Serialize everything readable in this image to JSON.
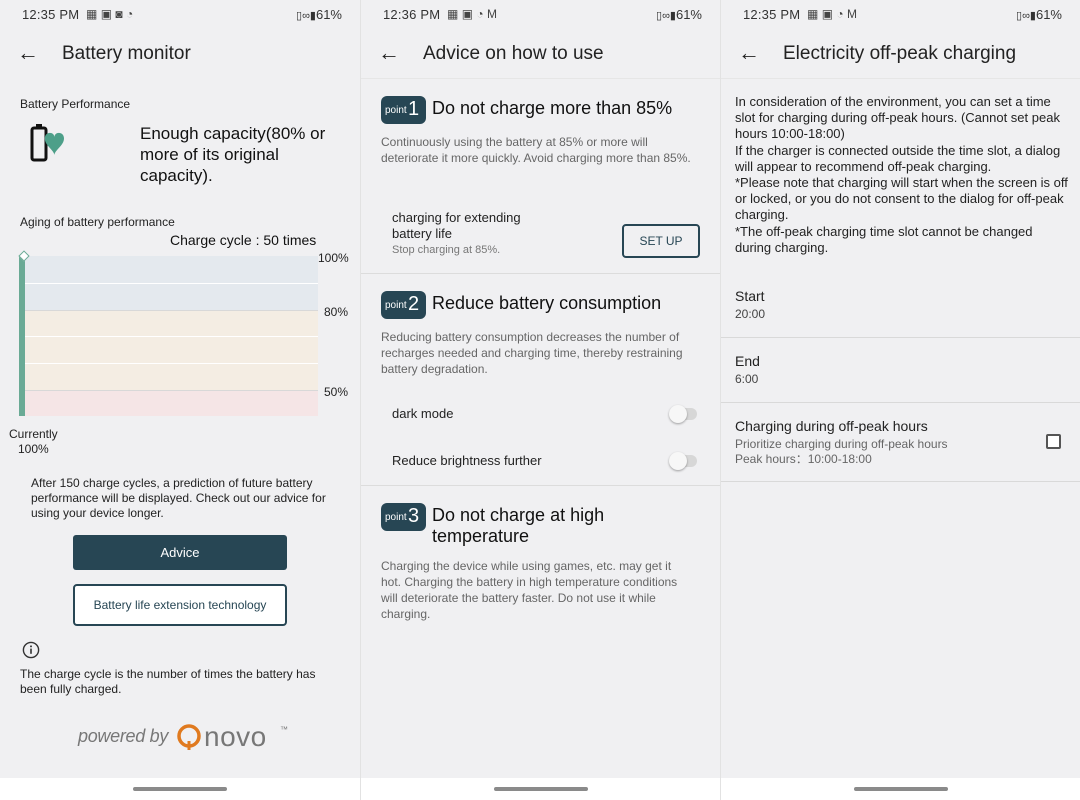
{
  "colors": {
    "accent": "#274654",
    "chart_line": "#6aaa95",
    "battery_heart": "#4d9f89"
  },
  "status_bars": [
    {
      "time": "12:35 PM",
      "icons": [
        "grid-icon",
        "image-icon",
        "camera-icon",
        "clock-icon"
      ],
      "battery": "61%"
    },
    {
      "time": "12:36 PM",
      "icons": [
        "grid-icon",
        "image-icon",
        "clock-icon",
        "mail-icon"
      ],
      "battery": "61%"
    },
    {
      "time": "12:35 PM",
      "icons": [
        "grid-icon",
        "image-icon",
        "clock-icon",
        "mail-icon"
      ],
      "battery": "61%"
    }
  ],
  "screen1": {
    "title": "Battery monitor",
    "performance_label": "Battery Performance",
    "capacity_text": "Enough capacity(80% or more of its original capacity).",
    "aging_label": "Aging of battery performance",
    "charge_cycle": "Charge cycle : 50 times",
    "y_labels": [
      "100%",
      "80%",
      "50%"
    ],
    "current_label": "Currently",
    "current_value": "100%",
    "prediction_note": "After 150 charge cycles, a prediction of future battery performance will be displayed. Check out our advice for using your device longer.",
    "advice_button": "Advice",
    "tech_button": "Battery life extension technology",
    "info_text": "The charge cycle is the number of times the battery has been fully charged.",
    "powered_by": "powered by",
    "brand": "novo"
  },
  "screen2": {
    "title": "Advice on how to use",
    "points": [
      {
        "word": "point",
        "num": "1",
        "title": "Do not charge more than 85%",
        "desc": "Continuously using the battery at 85% or more will deteriorate it more quickly. Avoid charging more than 85%."
      },
      {
        "word": "point",
        "num": "2",
        "title": "Reduce battery consumption",
        "desc": "Reducing battery consumption decreases the number of recharges needed and charging time, thereby restraining battery degradation."
      },
      {
        "word": "point",
        "num": "3",
        "title": "Do not charge at high temperature",
        "desc": "Charging the device while using games, etc. may get it hot. Charging the battery in high temperature conditions will deteriorate the battery faster. Do not use it while charging."
      }
    ],
    "extend_title": "charging for extending battery life",
    "extend_sub": "Stop charging at 85%.",
    "setup_button": "SET UP",
    "dark_mode": "dark mode",
    "brightness": "Reduce brightness further"
  },
  "screen3": {
    "title": "Electricity off-peak charging",
    "description": "In consideration of the environment, you can set a time slot for charging during off-peak hours. (Cannot set peak hours 10:00-18:00)\nIf the charger is connected outside the time slot, a dialog will appear to recommend off-peak charging.\n*Please note that charging will start when the screen is off or locked, or you do not consent to the dialog for off-peak charging.\n*The off-peak charging time slot cannot be changed during charging.",
    "start_label": "Start",
    "start_value": "20:00",
    "end_label": "End",
    "end_value": "6:00",
    "offpeak_title": "Charging during off-peak hours",
    "offpeak_sub": "Prioritize charging during off-peak hours",
    "peak_hours": "Peak hours：10:00-18:00"
  }
}
